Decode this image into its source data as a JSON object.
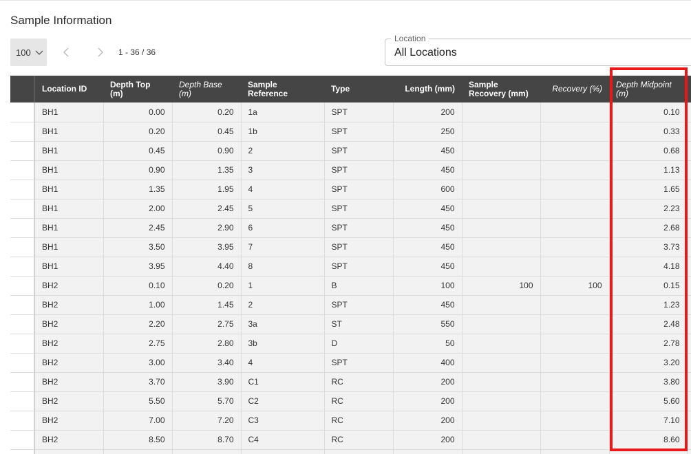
{
  "page": {
    "title": "Sample Information"
  },
  "pagination": {
    "page_size": "100",
    "range": "1 - 36 / 36"
  },
  "location_filter": {
    "label": "Location",
    "value": "All Locations"
  },
  "table": {
    "columns": [
      "",
      "Location ID",
      "Depth Top (m)",
      "Depth Base (m)",
      "Sample Reference",
      "Type",
      "Length (mm)",
      "Sample Recovery (mm)",
      "Recovery (%)",
      "Depth Midpoint (m)",
      ""
    ],
    "rows": [
      [
        "BH1",
        "0.00",
        "0.20",
        "1a",
        "SPT",
        "200",
        "",
        "",
        "0.10"
      ],
      [
        "BH1",
        "0.20",
        "0.45",
        "1b",
        "SPT",
        "250",
        "",
        "",
        "0.33"
      ],
      [
        "BH1",
        "0.45",
        "0.90",
        "2",
        "SPT",
        "450",
        "",
        "",
        "0.68"
      ],
      [
        "BH1",
        "0.90",
        "1.35",
        "3",
        "SPT",
        "450",
        "",
        "",
        "1.13"
      ],
      [
        "BH1",
        "1.35",
        "1.95",
        "4",
        "SPT",
        "600",
        "",
        "",
        "1.65"
      ],
      [
        "BH1",
        "2.00",
        "2.45",
        "5",
        "SPT",
        "450",
        "",
        "",
        "2.23"
      ],
      [
        "BH1",
        "2.45",
        "2.90",
        "6",
        "SPT",
        "450",
        "",
        "",
        "2.68"
      ],
      [
        "BH1",
        "3.50",
        "3.95",
        "7",
        "SPT",
        "450",
        "",
        "",
        "3.73"
      ],
      [
        "BH1",
        "3.95",
        "4.40",
        "8",
        "SPT",
        "450",
        "",
        "",
        "4.18"
      ],
      [
        "BH2",
        "0.10",
        "0.20",
        "1",
        "B",
        "100",
        "100",
        "100",
        "0.15"
      ],
      [
        "BH2",
        "1.00",
        "1.45",
        "2",
        "SPT",
        "450",
        "",
        "",
        "1.23"
      ],
      [
        "BH2",
        "2.20",
        "2.75",
        "3a",
        "ST",
        "550",
        "",
        "",
        "2.48"
      ],
      [
        "BH2",
        "2.75",
        "2.80",
        "3b",
        "D",
        "50",
        "",
        "",
        "2.78"
      ],
      [
        "BH2",
        "3.00",
        "3.40",
        "4",
        "SPT",
        "400",
        "",
        "",
        "3.20"
      ],
      [
        "BH2",
        "3.70",
        "3.90",
        "C1",
        "RC",
        "200",
        "",
        "",
        "3.80"
      ],
      [
        "BH2",
        "5.50",
        "5.70",
        "C2",
        "RC",
        "200",
        "",
        "",
        "5.60"
      ],
      [
        "BH2",
        "7.00",
        "7.20",
        "C3",
        "RC",
        "200",
        "",
        "",
        "7.10"
      ],
      [
        "BH2",
        "8.50",
        "8.70",
        "C4",
        "RC",
        "200",
        "",
        "",
        "8.60"
      ],
      [
        "",
        "",
        "",
        "",
        "",
        "",
        "",
        "",
        ""
      ]
    ]
  },
  "icons": {
    "page_size": "chevron-down-icon",
    "prev": "chevron-left-icon",
    "next": "chevron-right-icon"
  },
  "colors": {
    "header_bg": "#454545",
    "cell_bg": "#f2f2f2",
    "highlight": "#e8191a"
  }
}
